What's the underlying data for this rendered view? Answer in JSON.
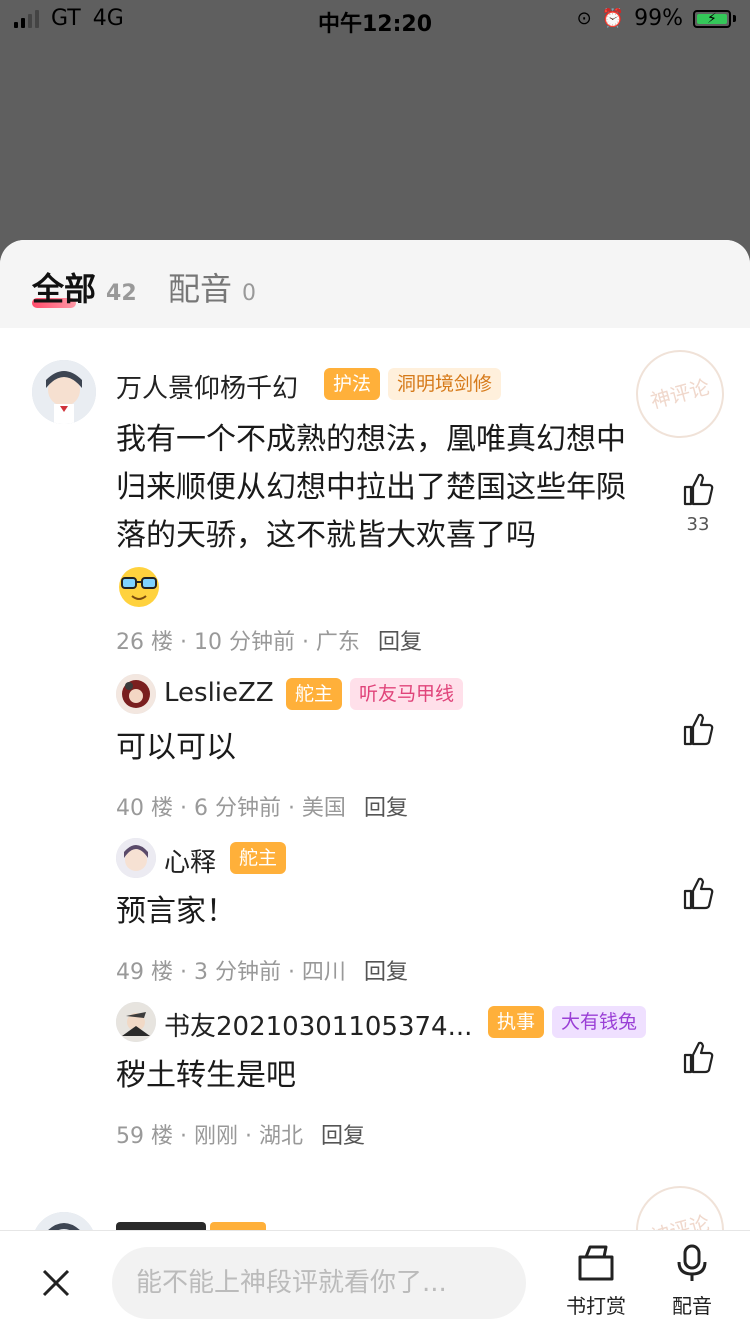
{
  "status": {
    "carrier": "GT",
    "network": "4G",
    "time": "中午12:20",
    "battery": "99%"
  },
  "tabs": [
    {
      "label": "全部",
      "count": "42"
    },
    {
      "label": "配音",
      "count": "0"
    }
  ],
  "comment": {
    "name": "万人景仰杨千幻",
    "badges": [
      "护法",
      "洞明境剑修"
    ],
    "text": "我有一个不成熟的想法，凰唯真幻想中归来顺便从幻想中拉出了楚国这些年陨落的天骄，这不就皆大欢喜了吗",
    "meta": "26 楼 · 10 分钟前 · 广东",
    "reply_label": "回复",
    "likes": "33",
    "stamp": "神评论"
  },
  "replies": [
    {
      "name": "LeslieZZ",
      "badges": [
        "舵主",
        "听友马甲线"
      ],
      "text": "可以可以",
      "meta": "40 楼 · 6 分钟前 · 美国",
      "reply_label": "回复"
    },
    {
      "name": "心释",
      "badges": [
        "舵主"
      ],
      "text": "预言家！",
      "meta": "49 楼 · 3 分钟前 · 四川",
      "reply_label": "回复"
    },
    {
      "name": "书友20210301105374...",
      "badges": [
        "执事",
        "大有钱兔"
      ],
      "text": "秽土转生是吧",
      "meta": "59 楼 · 刚刚 · 湖北",
      "reply_label": "回复"
    }
  ],
  "next_comment": {
    "stamp": "神评论"
  },
  "bottom": {
    "placeholder": "能不能上神段评就看你了...",
    "tip_label": "书打赏",
    "dub_label": "配音"
  }
}
